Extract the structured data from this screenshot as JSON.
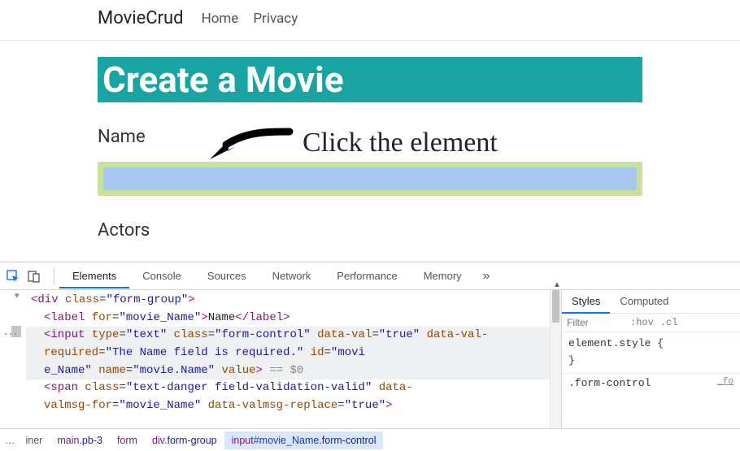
{
  "nav": {
    "brand": "MovieCrud",
    "links": [
      "Home",
      "Privacy"
    ]
  },
  "page": {
    "title": "Create a Movie",
    "field1_label": "Name",
    "field2_label": "Actors"
  },
  "annotation": {
    "text": "Click the element"
  },
  "devtools": {
    "tabs": [
      "Elements",
      "Console",
      "Sources",
      "Network",
      "Performance",
      "Memory"
    ],
    "activeTab": "Elements",
    "overflow": "»",
    "elements": {
      "line0": {
        "open": "<div ",
        "a1n": "class",
        "a1v": "form-group",
        "close": ">"
      },
      "line1": {
        "open": "<label ",
        "a1n": "for",
        "a1v": "movie_Name",
        "txt": "Name",
        "close": "</label>"
      },
      "line2seg1": "<input ",
      "line2_a": [
        {
          "n": "type",
          "v": "text"
        },
        {
          "n": "class",
          "v": "form-control"
        },
        {
          "n": "data-val",
          "v": "true"
        },
        {
          "n": "data-val-required",
          "v": "The Name field is required."
        },
        {
          "n": "id",
          "v": "movie_Name"
        },
        {
          "n": "name",
          "v": "movie.Name"
        },
        {
          "n": "value",
          "v": ""
        }
      ],
      "line2_tail": "> == $0",
      "line3": {
        "open": "<span ",
        "a": [
          {
            "n": "class",
            "v": "text-danger field-validation-valid"
          },
          {
            "n": "data-valmsg-for",
            "v": "movie_Name"
          },
          {
            "n": "data-valmsg-replace",
            "v": "true"
          }
        ],
        "close": ">"
      }
    },
    "side": {
      "tabs": [
        "Styles",
        "Computed"
      ],
      "activeTab": "Styles",
      "filter_placeholder": "Filter",
      "hov": ":hov",
      "cls": ".cl",
      "block1_sel": "element.style",
      "block2_sel": ".form-control",
      "block2_src": "_fo"
    },
    "crumbs": {
      "dots": "…",
      "items": [
        {
          "raw": "iner"
        },
        {
          "tag": "main",
          "cls": ".pb-3"
        },
        {
          "tag": "form"
        },
        {
          "tag": "div",
          "cls": ".form-group"
        },
        {
          "tag": "input",
          "id": "#movie_Name",
          "cls": ".form-control"
        }
      ],
      "activeIndex": 4
    }
  }
}
